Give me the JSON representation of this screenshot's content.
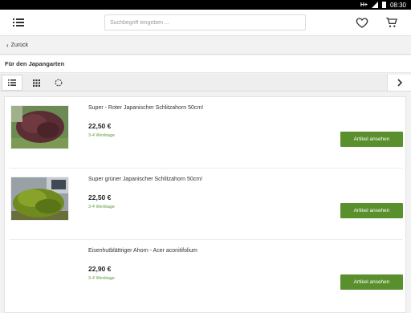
{
  "status_bar": {
    "signal": "H+",
    "time": "08:30"
  },
  "header": {
    "search_placeholder": "Suchbegriff eingeben ..."
  },
  "nav": {
    "back_label": "Zurück"
  },
  "page": {
    "title": "Für den Japangarten"
  },
  "toolbar": {
    "view_modes": [
      "list",
      "grid"
    ],
    "active_view": "list"
  },
  "products": [
    {
      "name": "Super - Roter Japanischer Schlitzahorn 50cm!",
      "price": "22,50 €",
      "delivery": "3-4 Werktage",
      "button": "Artikel ansehen"
    },
    {
      "name": "Super grüner Japanischer Schlitzahorn 50cm!",
      "price": "22,50 €",
      "delivery": "3-4 Werktage",
      "button": "Artikel ansehen"
    },
    {
      "name": "Eisenhutblättriger Ahorn - Acer aconitifolium",
      "price": "22,90 €",
      "delivery": "3-4 Werktage",
      "button": "Artikel ansehen"
    }
  ],
  "colors": {
    "accent_green": "#5a8f2e",
    "delivery_green": "#5a9a3a"
  }
}
